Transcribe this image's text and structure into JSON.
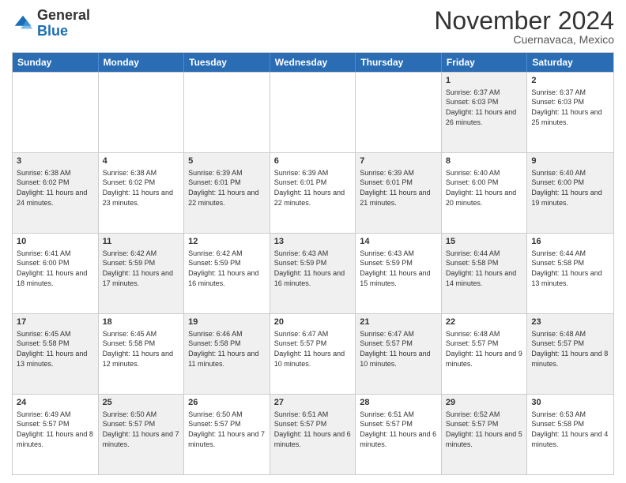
{
  "header": {
    "logo_general": "General",
    "logo_blue": "Blue",
    "month_title": "November 2024",
    "location": "Cuernavaca, Mexico"
  },
  "calendar": {
    "days_of_week": [
      "Sunday",
      "Monday",
      "Tuesday",
      "Wednesday",
      "Thursday",
      "Friday",
      "Saturday"
    ],
    "rows": [
      [
        {
          "day": "",
          "info": "",
          "shade": false
        },
        {
          "day": "",
          "info": "",
          "shade": false
        },
        {
          "day": "",
          "info": "",
          "shade": false
        },
        {
          "day": "",
          "info": "",
          "shade": false
        },
        {
          "day": "",
          "info": "",
          "shade": false
        },
        {
          "day": "1",
          "info": "Sunrise: 6:37 AM\nSunset: 6:03 PM\nDaylight: 11 hours and 26 minutes.",
          "shade": true
        },
        {
          "day": "2",
          "info": "Sunrise: 6:37 AM\nSunset: 6:03 PM\nDaylight: 11 hours and 25 minutes.",
          "shade": false
        }
      ],
      [
        {
          "day": "3",
          "info": "Sunrise: 6:38 AM\nSunset: 6:02 PM\nDaylight: 11 hours and 24 minutes.",
          "shade": true
        },
        {
          "day": "4",
          "info": "Sunrise: 6:38 AM\nSunset: 6:02 PM\nDaylight: 11 hours and 23 minutes.",
          "shade": false
        },
        {
          "day": "5",
          "info": "Sunrise: 6:39 AM\nSunset: 6:01 PM\nDaylight: 11 hours and 22 minutes.",
          "shade": true
        },
        {
          "day": "6",
          "info": "Sunrise: 6:39 AM\nSunset: 6:01 PM\nDaylight: 11 hours and 22 minutes.",
          "shade": false
        },
        {
          "day": "7",
          "info": "Sunrise: 6:39 AM\nSunset: 6:01 PM\nDaylight: 11 hours and 21 minutes.",
          "shade": true
        },
        {
          "day": "8",
          "info": "Sunrise: 6:40 AM\nSunset: 6:00 PM\nDaylight: 11 hours and 20 minutes.",
          "shade": false
        },
        {
          "day": "9",
          "info": "Sunrise: 6:40 AM\nSunset: 6:00 PM\nDaylight: 11 hours and 19 minutes.",
          "shade": true
        }
      ],
      [
        {
          "day": "10",
          "info": "Sunrise: 6:41 AM\nSunset: 6:00 PM\nDaylight: 11 hours and 18 minutes.",
          "shade": false
        },
        {
          "day": "11",
          "info": "Sunrise: 6:42 AM\nSunset: 5:59 PM\nDaylight: 11 hours and 17 minutes.",
          "shade": true
        },
        {
          "day": "12",
          "info": "Sunrise: 6:42 AM\nSunset: 5:59 PM\nDaylight: 11 hours and 16 minutes.",
          "shade": false
        },
        {
          "day": "13",
          "info": "Sunrise: 6:43 AM\nSunset: 5:59 PM\nDaylight: 11 hours and 16 minutes.",
          "shade": true
        },
        {
          "day": "14",
          "info": "Sunrise: 6:43 AM\nSunset: 5:59 PM\nDaylight: 11 hours and 15 minutes.",
          "shade": false
        },
        {
          "day": "15",
          "info": "Sunrise: 6:44 AM\nSunset: 5:58 PM\nDaylight: 11 hours and 14 minutes.",
          "shade": true
        },
        {
          "day": "16",
          "info": "Sunrise: 6:44 AM\nSunset: 5:58 PM\nDaylight: 11 hours and 13 minutes.",
          "shade": false
        }
      ],
      [
        {
          "day": "17",
          "info": "Sunrise: 6:45 AM\nSunset: 5:58 PM\nDaylight: 11 hours and 13 minutes.",
          "shade": true
        },
        {
          "day": "18",
          "info": "Sunrise: 6:45 AM\nSunset: 5:58 PM\nDaylight: 11 hours and 12 minutes.",
          "shade": false
        },
        {
          "day": "19",
          "info": "Sunrise: 6:46 AM\nSunset: 5:58 PM\nDaylight: 11 hours and 11 minutes.",
          "shade": true
        },
        {
          "day": "20",
          "info": "Sunrise: 6:47 AM\nSunset: 5:57 PM\nDaylight: 11 hours and 10 minutes.",
          "shade": false
        },
        {
          "day": "21",
          "info": "Sunrise: 6:47 AM\nSunset: 5:57 PM\nDaylight: 11 hours and 10 minutes.",
          "shade": true
        },
        {
          "day": "22",
          "info": "Sunrise: 6:48 AM\nSunset: 5:57 PM\nDaylight: 11 hours and 9 minutes.",
          "shade": false
        },
        {
          "day": "23",
          "info": "Sunrise: 6:48 AM\nSunset: 5:57 PM\nDaylight: 11 hours and 8 minutes.",
          "shade": true
        }
      ],
      [
        {
          "day": "24",
          "info": "Sunrise: 6:49 AM\nSunset: 5:57 PM\nDaylight: 11 hours and 8 minutes.",
          "shade": false
        },
        {
          "day": "25",
          "info": "Sunrise: 6:50 AM\nSunset: 5:57 PM\nDaylight: 11 hours and 7 minutes.",
          "shade": true
        },
        {
          "day": "26",
          "info": "Sunrise: 6:50 AM\nSunset: 5:57 PM\nDaylight: 11 hours and 7 minutes.",
          "shade": false
        },
        {
          "day": "27",
          "info": "Sunrise: 6:51 AM\nSunset: 5:57 PM\nDaylight: 11 hours and 6 minutes.",
          "shade": true
        },
        {
          "day": "28",
          "info": "Sunrise: 6:51 AM\nSunset: 5:57 PM\nDaylight: 11 hours and 6 minutes.",
          "shade": false
        },
        {
          "day": "29",
          "info": "Sunrise: 6:52 AM\nSunset: 5:57 PM\nDaylight: 11 hours and 5 minutes.",
          "shade": true
        },
        {
          "day": "30",
          "info": "Sunrise: 6:53 AM\nSunset: 5:58 PM\nDaylight: 11 hours and 4 minutes.",
          "shade": false
        }
      ]
    ]
  }
}
